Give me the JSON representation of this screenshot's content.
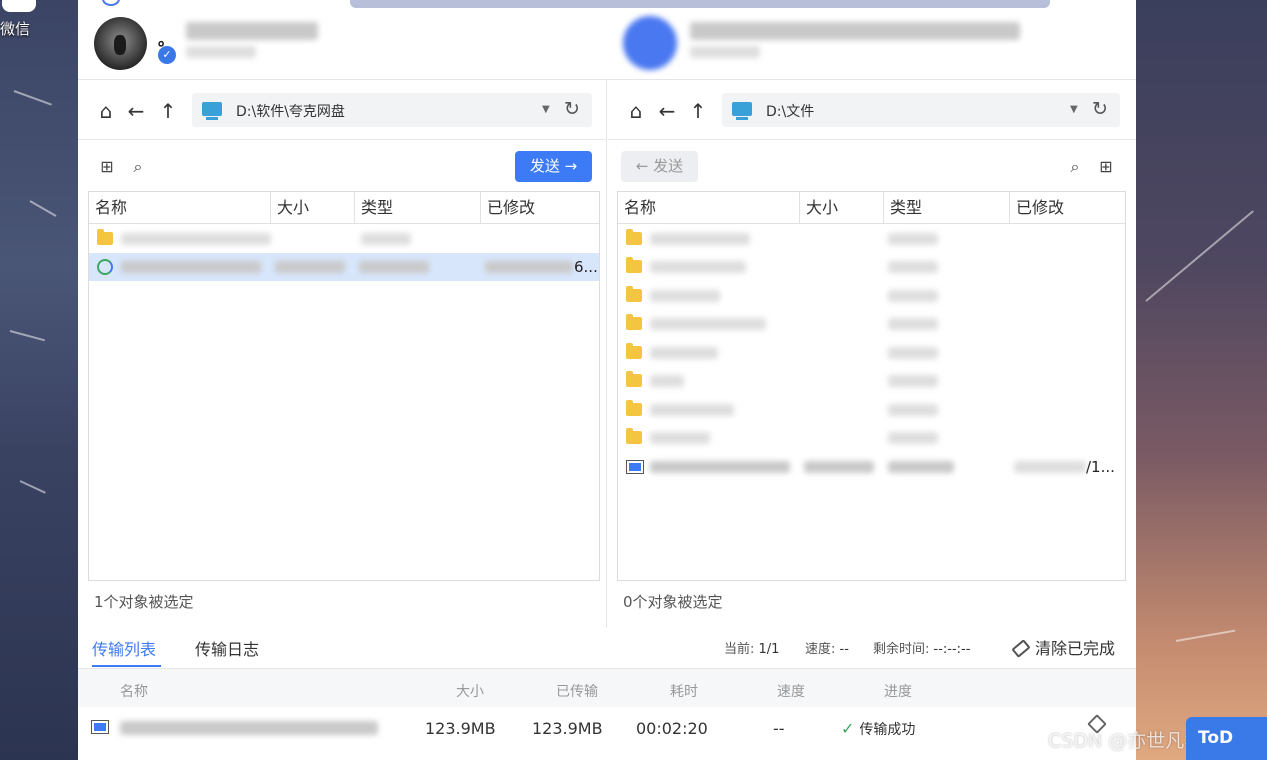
{
  "desktop": {
    "wechat_label": "微信",
    "watermark": "CSDN @亦世凡华",
    "todo_badge": "ToD"
  },
  "header": {
    "device_name": "。",
    "verified_icon": "check-badge-icon"
  },
  "left_pane": {
    "path": "D:\\软件\\夸克网盘",
    "send_label": "发送 →",
    "columns": [
      "名称",
      "大小",
      "类型",
      "已修改"
    ],
    "rows": [
      {
        "icon": "folder-icon",
        "trail": ""
      },
      {
        "icon": "quark-app-icon",
        "trail": "6...",
        "selected": true
      }
    ],
    "status": "1个对象被选定"
  },
  "right_pane": {
    "path": "D:\\文件",
    "send_label": "← 发送",
    "columns": [
      "名称",
      "大小",
      "类型",
      "已修改"
    ],
    "rows": [
      {
        "icon": "folder-icon",
        "trail": ""
      },
      {
        "icon": "folder-icon",
        "trail": ""
      },
      {
        "icon": "folder-icon",
        "trail": ""
      },
      {
        "icon": "folder-icon",
        "trail": ""
      },
      {
        "icon": "folder-icon",
        "trail": ""
      },
      {
        "icon": "folder-icon",
        "trail": ""
      },
      {
        "icon": "folder-icon",
        "trail": ""
      },
      {
        "icon": "folder-icon",
        "trail": ""
      },
      {
        "icon": "exe-icon",
        "trail": "/1..."
      }
    ],
    "status": "0个对象被选定"
  },
  "transfer": {
    "tabs": [
      "传输列表",
      "传输日志"
    ],
    "current_label": "当前:",
    "current_value": "1/1",
    "speed_label": "速度:",
    "speed_value": "--",
    "remaining_label": "剩余时间:",
    "remaining_value": "--:--:--",
    "clear_label": "清除已完成",
    "columns": [
      "名称",
      "大小",
      "已传输",
      "耗时",
      "速度",
      "进度"
    ],
    "row": {
      "size": "123.9MB",
      "transferred": "123.9MB",
      "elapsed": "00:02:20",
      "speed": "--",
      "progress": "传输成功"
    }
  }
}
